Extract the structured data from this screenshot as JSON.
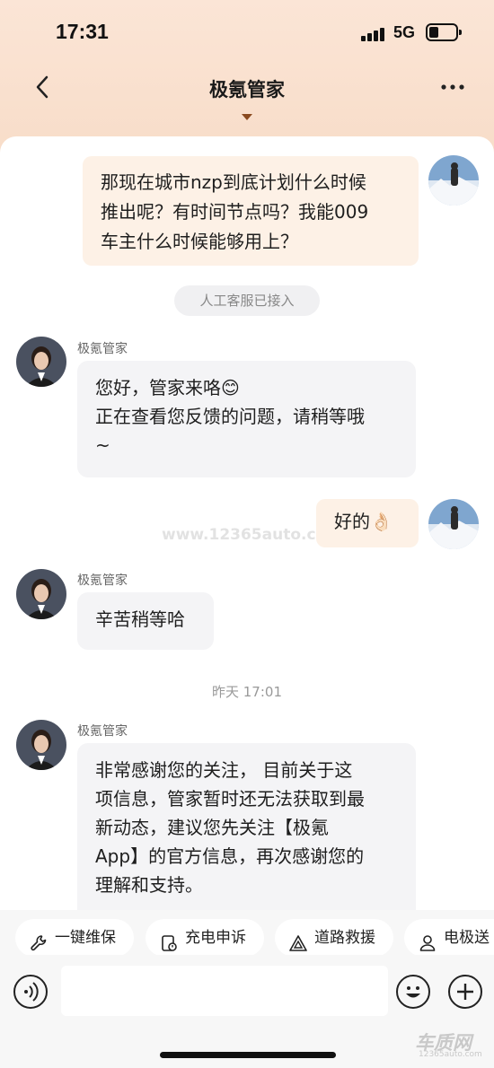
{
  "status_bar": {
    "time": "17:31",
    "network": "5G"
  },
  "nav": {
    "title": "极氪管家"
  },
  "messages": {
    "user_question": [
      "那现在城市nzp到底计划什么时候",
      "推出呢？有时间节点吗？我能009",
      "车主什么时候能够用上？"
    ],
    "system_notice": "人工客服已接入",
    "agent_name": "极氪管家",
    "agent_msg_1": [
      "您好，管家来咯😊",
      "正在查看您反馈的问题，请稍等哦",
      "~"
    ],
    "user_reply": "好的👌🏻",
    "agent_msg_2": "辛苦稍等哈",
    "timestamp": "昨天 17:01",
    "agent_msg_3": [
      "非常感谢您的关注， 目前关于这",
      "项信息，管家暂时还无法获取到最",
      "新动态，建议您先关注【极氪",
      "App】的官方信息，再次感谢您的",
      "理解和支持。"
    ]
  },
  "watermark": "www.12365auto.com",
  "quick_actions": [
    {
      "label": "一键维保",
      "icon": "wrench-icon"
    },
    {
      "label": "充电申诉",
      "icon": "charge-complaint-icon"
    },
    {
      "label": "道路救援",
      "icon": "warning-triangle-icon"
    },
    {
      "label": "电极送",
      "icon": "person-icon"
    }
  ],
  "corner_brand": {
    "logo": "车质网",
    "url": "12365auto.com"
  },
  "colors": {
    "header_bg": "#fbe5d6",
    "user_bubble": "#fdf1e6",
    "agent_bubble": "#f4f4f6",
    "caret": "#8a4a1f"
  }
}
